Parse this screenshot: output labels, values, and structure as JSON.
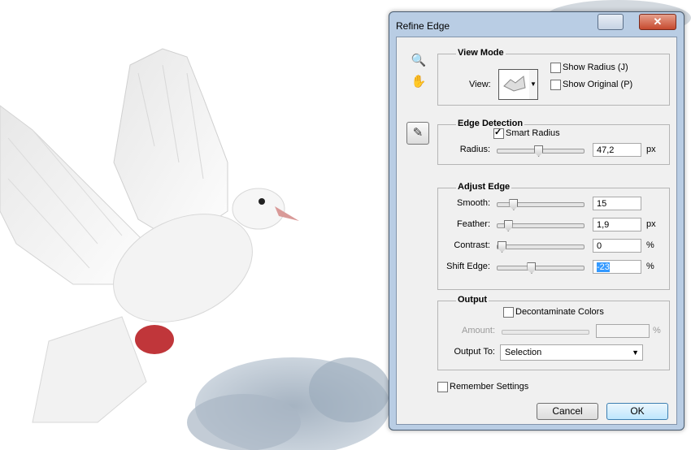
{
  "dialog": {
    "title": "Refine Edge",
    "close_glyph": "✕",
    "view_mode": {
      "heading": "View Mode",
      "view_label": "View:",
      "show_radius": {
        "label": "Show Radius (J)",
        "checked": false
      },
      "show_original": {
        "label": "Show Original (P)",
        "checked": false
      }
    },
    "edge_detection": {
      "heading": "Edge Detection",
      "smart_radius": {
        "label": "Smart Radius",
        "checked": true
      },
      "radius": {
        "label": "Radius:",
        "value": "47,2",
        "unit": "px",
        "level": 0.47
      }
    },
    "adjust_edge": {
      "heading": "Adjust Edge",
      "smooth": {
        "label": "Smooth:",
        "value": "15",
        "unit": "",
        "level": 0.15
      },
      "feather": {
        "label": "Feather:",
        "value": "1,9",
        "unit": "px",
        "level": 0.08
      },
      "contrast": {
        "label": "Contrast:",
        "value": "0",
        "unit": "%",
        "level": 0.0
      },
      "shift_edge": {
        "label": "Shift Edge:",
        "value": "-23",
        "unit": "%",
        "level": 0.38
      }
    },
    "output": {
      "heading": "Output",
      "decontaminate": {
        "label": "Decontaminate Colors",
        "checked": false
      },
      "amount": {
        "label": "Amount:",
        "unit": "%"
      },
      "output_to": {
        "label": "Output To:",
        "value": "Selection"
      }
    },
    "remember": {
      "label": "Remember Settings",
      "checked": false
    },
    "cancel_label": "Cancel",
    "ok_label": "OK",
    "icons": {
      "zoom": "zoom-icon",
      "hand": "hand-icon",
      "brush": "refine-radius-brush-icon"
    }
  }
}
